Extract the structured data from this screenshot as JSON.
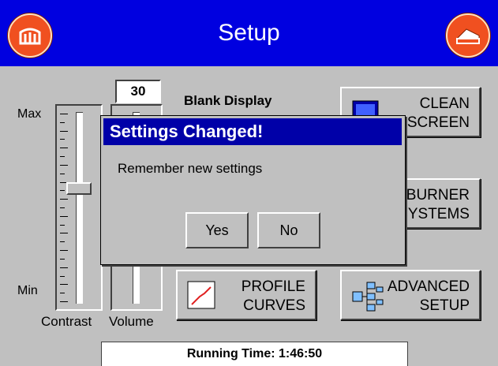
{
  "header": {
    "title": "Setup",
    "home_icon": "home-icon",
    "back_icon": "back-icon",
    "accent_color": "#0000e0",
    "button_color": "#f05020"
  },
  "contrast": {
    "max_label": "Max",
    "min_label": "Min",
    "label": "Contrast",
    "level": 0.6
  },
  "volume": {
    "value": "30",
    "label": "Volume"
  },
  "blank_display": {
    "label": "Blank Display"
  },
  "buttons": {
    "clean_screen": [
      "CLEAN",
      "SCREEN"
    ],
    "burner_systems": [
      "BURNER",
      "SYSTEMS"
    ],
    "profile_curves": [
      "PROFILE",
      "CURVES"
    ],
    "advanced_setup": [
      "ADVANCED",
      "SETUP"
    ]
  },
  "dialog": {
    "title": "Settings Changed!",
    "message": "Remember new settings",
    "yes_label": "Yes",
    "no_label": "No",
    "title_color": "#0000a8"
  },
  "status": {
    "running_time": "Running Time: 1:46:50"
  }
}
